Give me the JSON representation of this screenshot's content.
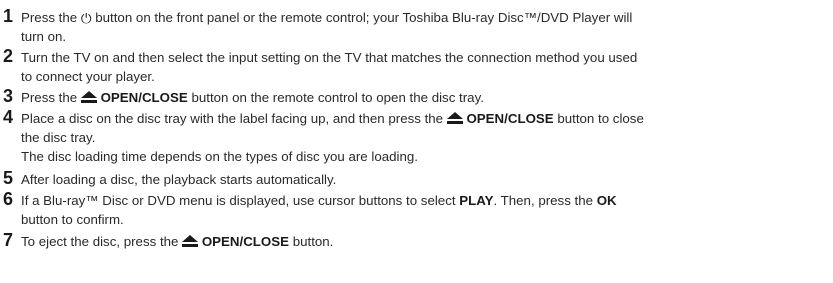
{
  "steps": [
    {
      "number": "1",
      "pre": "Press the ",
      "icon": "power-icon",
      "line1_rest": " button on the front panel or the remote control; your Toshiba Blu-ray Disc™/DVD Player will",
      "line2": "turn on."
    },
    {
      "number": "2",
      "line1": "Turn the TV on and then select the input setting on the TV that matches the connection method you used",
      "line2": "to connect your player."
    },
    {
      "number": "3",
      "pre": "Press the ",
      "icon": "eject-icon",
      "bold": "OPEN/CLOSE",
      "post": " button on the remote control to open the disc tray."
    },
    {
      "number": "4",
      "pre": "Place a disc on the disc tray with the label facing up, and then press the ",
      "icon": "eject-icon",
      "bold": "OPEN/CLOSE",
      "post": " button to close",
      "line2": "the disc tray.",
      "line3": "The disc loading time depends on the types of disc you are loading."
    },
    {
      "number": "5",
      "line1": "After loading a disc, the playback starts automatically."
    },
    {
      "number": "6",
      "pre": "If a Blu-ray™ Disc or DVD menu is displayed, use cursor buttons to select ",
      "bold1": "PLAY",
      "mid": ". Then, press the ",
      "bold2": "OK",
      "line2": "button to confirm."
    },
    {
      "number": "7",
      "pre": "To eject the disc, press the ",
      "icon": "eject-icon",
      "bold": "OPEN/CLOSE",
      "post": " button."
    }
  ]
}
